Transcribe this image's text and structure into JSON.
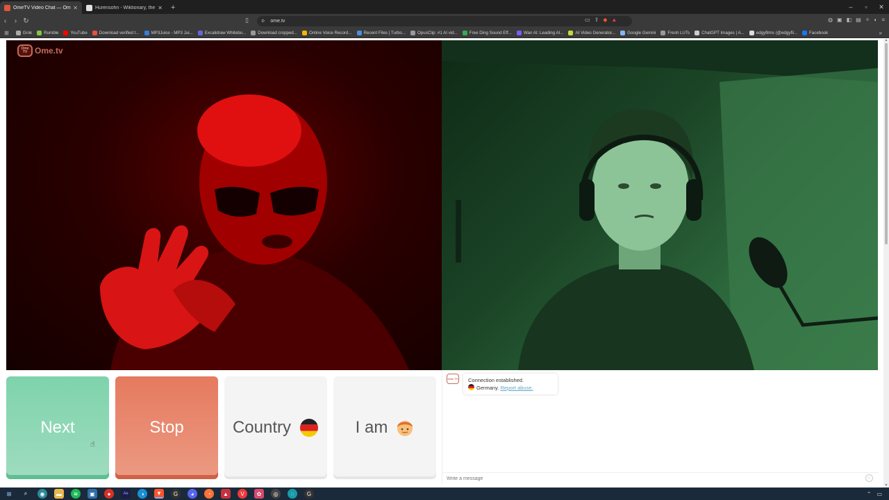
{
  "browser": {
    "tabs": [
      {
        "title": "OmeTV Video Chat — Omeg",
        "active": true,
        "favicon_color": "#e2533b"
      },
      {
        "title": "Hurensohn - Wiktionary, the free dict",
        "active": false,
        "favicon_color": "#e0e0e0"
      }
    ],
    "new_tab_label": "+",
    "window_controls": [
      "–",
      "▫",
      "✕"
    ],
    "url": "ome.tv",
    "bookmarks": [
      {
        "label": "Grok",
        "color": "#aaaaaa"
      },
      {
        "label": "Rumble",
        "color": "#85c742"
      },
      {
        "label": "YouTube",
        "color": "#ff0000"
      },
      {
        "label": "Download verified t...",
        "color": "#e5533b"
      },
      {
        "label": "MP3Juice - MP3 Jui...",
        "color": "#3b7bd8"
      },
      {
        "label": "Excalidraw Whitebo...",
        "color": "#6965db"
      },
      {
        "label": "Download cropped...",
        "color": "#999999"
      },
      {
        "label": "Online Voice Record...",
        "color": "#f4b400"
      },
      {
        "label": "Recent Files | Turbo...",
        "color": "#4a90d9"
      },
      {
        "label": "OpusClip: #1 AI vid...",
        "color": "#999999"
      },
      {
        "label": "Free Ding Sound Eff...",
        "color": "#3aa757"
      },
      {
        "label": "Wan AI: Leading AI...",
        "color": "#7c5cff"
      },
      {
        "label": "AI Video Generator...",
        "color": "#c6d93a"
      },
      {
        "label": "Google Gemini",
        "color": "#8ab4f8"
      },
      {
        "label": "Fresh LUTs",
        "color": "#999999"
      },
      {
        "label": "ChatGPT Images | A...",
        "color": "#cccccc"
      },
      {
        "label": "edgyfilms (@edgyfil...",
        "color": "#dddddd"
      },
      {
        "label": "Facebook",
        "color": "#1877f2"
      }
    ]
  },
  "site": {
    "logo_text": "Ome.tv",
    "logo_badge": "Ome TV",
    "buttons": {
      "next": "Next",
      "stop": "Stop",
      "country": "Country",
      "iam": "I am"
    },
    "chat": {
      "system_message": "Connection established.",
      "location": "Germany.",
      "report_link": "Report abuse.",
      "input_placeholder": "Write a message"
    }
  },
  "colors": {
    "next": "#8ed7b6",
    "stop": "#e98a70",
    "brand": "#c76b5b",
    "remote_tint": "#3a0000",
    "local_tint": "#2a5a36"
  },
  "taskbar": {
    "apps": [
      "start-icon",
      "search-icon",
      "copilot-icon",
      "file-explorer-icon",
      "spotify-icon",
      "edge-tab-icon",
      "after-effects-icon",
      "edge-icon",
      "brave-icon",
      "chatgpt-icon",
      "discord-icon",
      "firefox-icon",
      "app-red-icon",
      "vivaldi-icon",
      "app-pink-icon",
      "obs-icon",
      "app-teal-icon",
      "app-circle-icon"
    ]
  }
}
